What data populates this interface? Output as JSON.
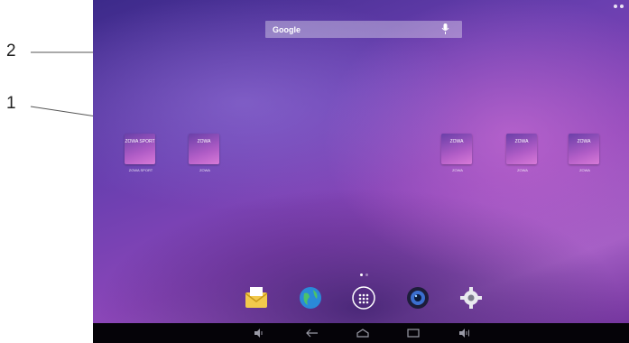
{
  "callouts": [
    {
      "number": "1"
    },
    {
      "number": "2"
    }
  ],
  "search": {
    "google_label": "Google",
    "icon": "mic-icon"
  },
  "home_apps": [
    {
      "tile_text": "ZOWA SPORT",
      "label": "ZOWA SPORT"
    },
    {
      "tile_text": "ZOWA",
      "label": "ZOWA"
    },
    {
      "tile_text": "ZOWA",
      "label": "ZOWA"
    },
    {
      "tile_text": "ZOWA",
      "label": "ZOWA"
    },
    {
      "tile_text": "ZOWA",
      "label": "ZOWA"
    }
  ],
  "dock": [
    {
      "icon": "email-icon"
    },
    {
      "icon": "browser-icon"
    },
    {
      "icon": "app-drawer-icon"
    },
    {
      "icon": "camera-icon"
    },
    {
      "icon": "settings-icon"
    }
  ],
  "nav_bar": [
    {
      "icon": "volume-down-icon"
    },
    {
      "icon": "back-icon"
    },
    {
      "icon": "home-icon"
    },
    {
      "icon": "recent-apps-icon"
    },
    {
      "icon": "volume-up-icon"
    }
  ],
  "colors": {
    "wallpaper_primary": "#6a3fb0",
    "wallpaper_secondary": "#a35ec4",
    "nav_bar": "#050308"
  }
}
